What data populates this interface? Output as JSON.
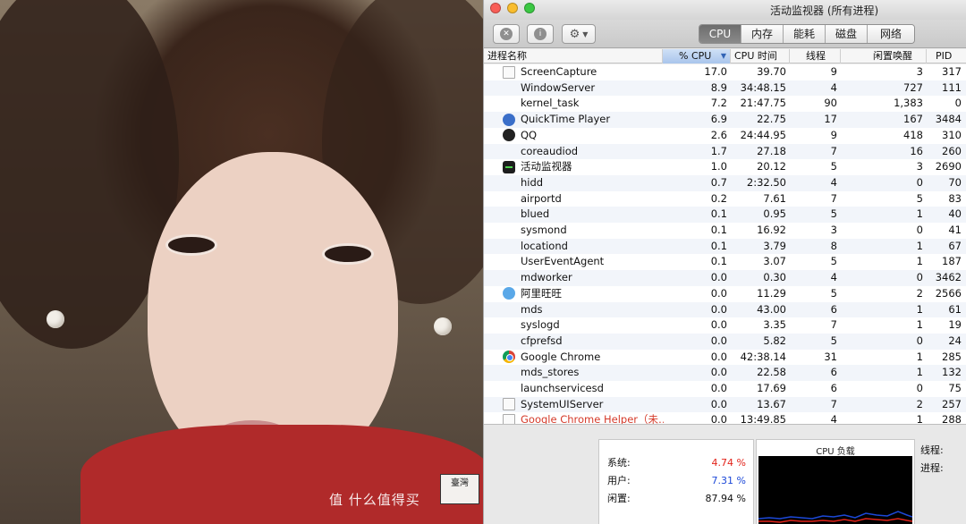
{
  "photo": {
    "seal_text": "臺灣"
  },
  "window": {
    "title": "活动监视器 (所有进程)",
    "toolbar": {
      "quit_icon": "x-circle-icon",
      "info_icon": "info-circle-icon",
      "gear_icon": "gear-icon",
      "tabs": [
        {
          "label": "CPU",
          "active": true
        },
        {
          "label": "内存",
          "active": false
        },
        {
          "label": "能耗",
          "active": false
        },
        {
          "label": "磁盘",
          "active": false
        },
        {
          "label": "网络",
          "active": false
        }
      ]
    },
    "columns": {
      "name": "进程名称",
      "cpu": "% CPU",
      "cpu_time": "CPU 时间",
      "threads": "线程",
      "idle_wakeups": "闲置唤醒",
      "pid": "PID"
    },
    "processes": [
      {
        "icon": "document-icon",
        "name": "ScreenCapture",
        "cpu": "17.0",
        "time": "39.70",
        "threads": "9",
        "wakeups": "3",
        "pid": "317"
      },
      {
        "icon": "",
        "name": "WindowServer",
        "cpu": "8.9",
        "time": "34:48.15",
        "threads": "4",
        "wakeups": "727",
        "pid": "111"
      },
      {
        "icon": "",
        "name": "kernel_task",
        "cpu": "7.2",
        "time": "21:47.75",
        "threads": "90",
        "wakeups": "1,383",
        "pid": "0"
      },
      {
        "icon": "quicktime-icon",
        "name": "QuickTime Player",
        "cpu": "6.9",
        "time": "22.75",
        "threads": "17",
        "wakeups": "167",
        "pid": "3484"
      },
      {
        "icon": "qq-penguin-icon",
        "name": "QQ",
        "cpu": "2.6",
        "time": "24:44.95",
        "threads": "9",
        "wakeups": "418",
        "pid": "310"
      },
      {
        "icon": "",
        "name": "coreaudiod",
        "cpu": "1.7",
        "time": "27.18",
        "threads": "7",
        "wakeups": "16",
        "pid": "260"
      },
      {
        "icon": "activity-monitor-icon",
        "name": "活动监视器",
        "cpu": "1.0",
        "time": "20.12",
        "threads": "5",
        "wakeups": "3",
        "pid": "2690"
      },
      {
        "icon": "",
        "name": "hidd",
        "cpu": "0.7",
        "time": "2:32.50",
        "threads": "4",
        "wakeups": "0",
        "pid": "70"
      },
      {
        "icon": "",
        "name": "airportd",
        "cpu": "0.2",
        "time": "7.61",
        "threads": "7",
        "wakeups": "5",
        "pid": "83"
      },
      {
        "icon": "",
        "name": "blued",
        "cpu": "0.1",
        "time": "0.95",
        "threads": "5",
        "wakeups": "1",
        "pid": "40"
      },
      {
        "icon": "",
        "name": "sysmond",
        "cpu": "0.1",
        "time": "16.92",
        "threads": "3",
        "wakeups": "0",
        "pid": "41"
      },
      {
        "icon": "",
        "name": "locationd",
        "cpu": "0.1",
        "time": "3.79",
        "threads": "8",
        "wakeups": "1",
        "pid": "67"
      },
      {
        "icon": "",
        "name": "UserEventAgent",
        "cpu": "0.1",
        "time": "3.07",
        "threads": "5",
        "wakeups": "1",
        "pid": "187"
      },
      {
        "icon": "",
        "name": "mdworker",
        "cpu": "0.0",
        "time": "0.30",
        "threads": "4",
        "wakeups": "0",
        "pid": "3462"
      },
      {
        "icon": "aliwangwang-icon",
        "name": "阿里旺旺",
        "cpu": "0.0",
        "time": "11.29",
        "threads": "5",
        "wakeups": "2",
        "pid": "2566"
      },
      {
        "icon": "",
        "name": "mds",
        "cpu": "0.0",
        "time": "43.00",
        "threads": "6",
        "wakeups": "1",
        "pid": "61"
      },
      {
        "icon": "",
        "name": "syslogd",
        "cpu": "0.0",
        "time": "3.35",
        "threads": "7",
        "wakeups": "1",
        "pid": "19"
      },
      {
        "icon": "",
        "name": "cfprefsd",
        "cpu": "0.0",
        "time": "5.82",
        "threads": "5",
        "wakeups": "0",
        "pid": "24"
      },
      {
        "icon": "chrome-icon",
        "name": "Google Chrome",
        "cpu": "0.0",
        "time": "42:38.14",
        "threads": "31",
        "wakeups": "1",
        "pid": "285"
      },
      {
        "icon": "",
        "name": "mds_stores",
        "cpu": "0.0",
        "time": "22.58",
        "threads": "6",
        "wakeups": "1",
        "pid": "132"
      },
      {
        "icon": "",
        "name": "launchservicesd",
        "cpu": "0.0",
        "time": "17.69",
        "threads": "6",
        "wakeups": "0",
        "pid": "75"
      },
      {
        "icon": "document-icon",
        "name": "SystemUIServer",
        "cpu": "0.0",
        "time": "13.67",
        "threads": "7",
        "wakeups": "2",
        "pid": "257"
      },
      {
        "icon": "document-icon",
        "name": "Google Chrome Helper（未…",
        "cpu": "0.0",
        "time": "13:49.85",
        "threads": "4",
        "wakeups": "1",
        "pid": "288",
        "not_responding": true
      }
    ],
    "summary": {
      "system_label": "系统:",
      "system_value": "4.74 %",
      "user_label": "用户:",
      "user_value": "7.31 %",
      "idle_label": "闲置:",
      "idle_value": "87.94 %",
      "graph_title": "CPU 负载",
      "threads_label": "线程:",
      "processes_label": "进程:"
    },
    "colors": {
      "system": "#e2231a",
      "user": "#1c48d8",
      "selected_header": "#a9c5ec"
    }
  },
  "watermark": "值 什么值得买"
}
